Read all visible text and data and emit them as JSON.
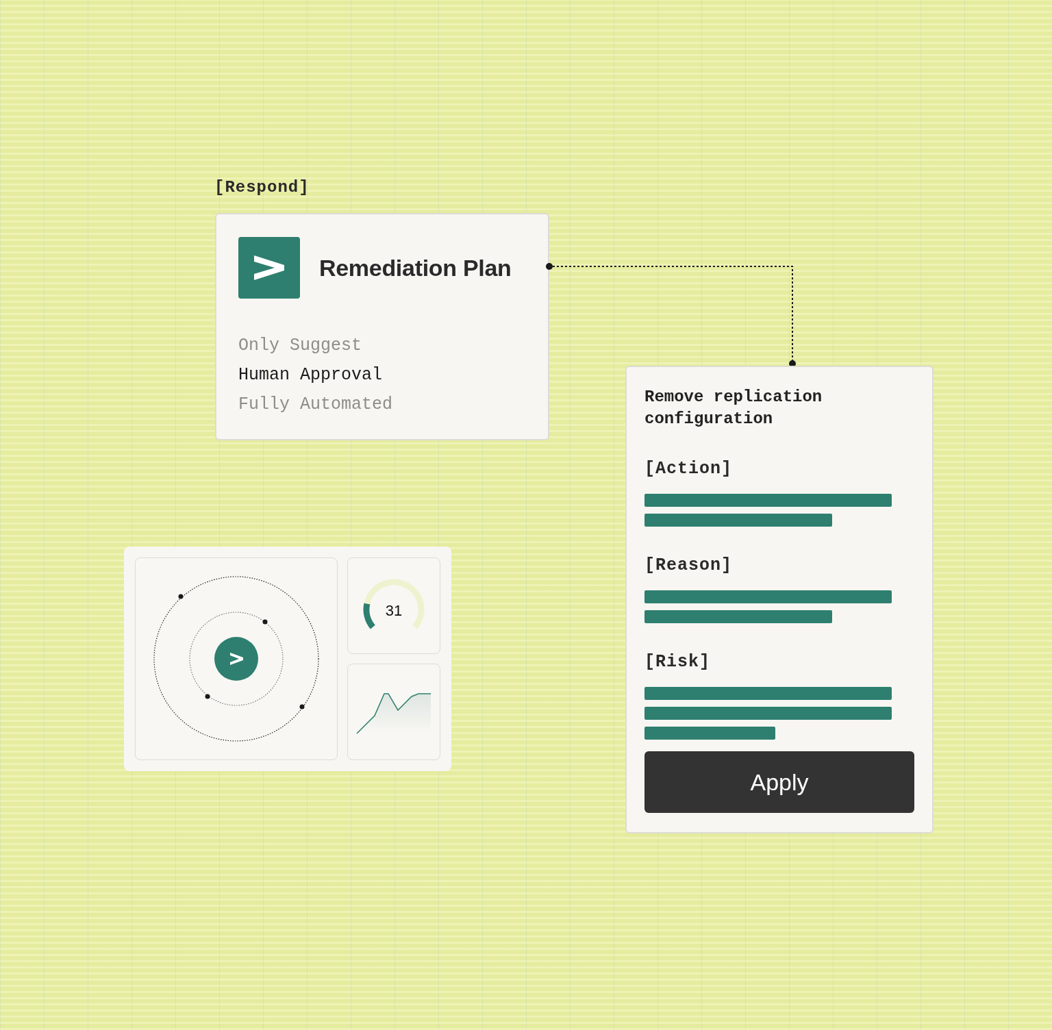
{
  "label": "[Respond]",
  "plan": {
    "title": "Remediation Plan",
    "options": [
      {
        "label": "Only Suggest",
        "selected": false
      },
      {
        "label": "Human Approval",
        "selected": true
      },
      {
        "label": "Fully Automated",
        "selected": false
      }
    ]
  },
  "dashboard": {
    "gauge": {
      "value": "31",
      "level": 0.2
    }
  },
  "detail": {
    "title": "Remove replication configuration",
    "sections": [
      {
        "label": "[Action]"
      },
      {
        "label": "[Reason]"
      },
      {
        "label": "[Risk]"
      }
    ],
    "button": "Apply"
  }
}
